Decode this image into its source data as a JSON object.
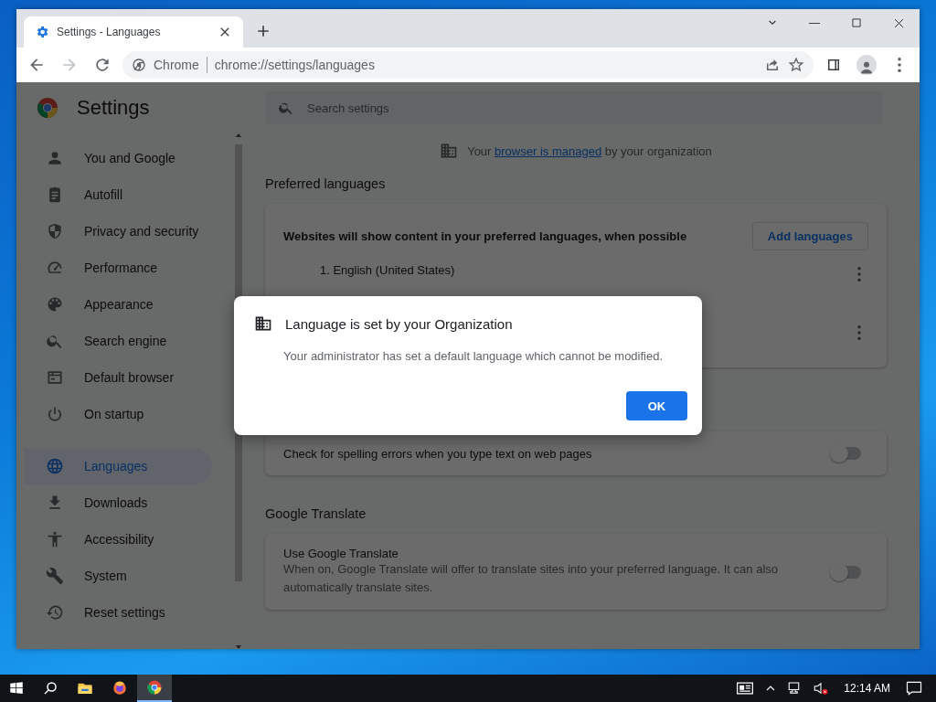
{
  "tab": {
    "title": "Settings - Languages",
    "selected": true
  },
  "omnibox": {
    "chip": "Chrome",
    "url": "chrome://settings/languages"
  },
  "settings_header": {
    "title": "Settings",
    "search_placeholder": "Search settings"
  },
  "sidebar": {
    "groups": [
      {
        "items": [
          {
            "label": "You and Google",
            "selected": false
          },
          {
            "label": "Autofill",
            "selected": false
          },
          {
            "label": "Privacy and security",
            "selected": false
          },
          {
            "label": "Performance",
            "selected": false
          },
          {
            "label": "Appearance",
            "selected": false
          },
          {
            "label": "Search engine",
            "selected": false
          },
          {
            "label": "Default browser",
            "selected": false
          },
          {
            "label": "On startup",
            "selected": false
          }
        ]
      },
      {
        "items": [
          {
            "label": "Languages",
            "selected": true
          },
          {
            "label": "Downloads",
            "selected": false
          },
          {
            "label": "Accessibility",
            "selected": false
          },
          {
            "label": "System",
            "selected": false
          },
          {
            "label": "Reset settings",
            "selected": false
          }
        ]
      }
    ]
  },
  "managed_notice": {
    "before": "Your",
    "link": "browser is managed",
    "after": "by your organization"
  },
  "preferred_languages": {
    "heading": "Preferred languages",
    "description": "Websites will show content in your preferred languages, when possible",
    "add_button": "Add languages",
    "rows": [
      {
        "kind": "language",
        "label": "1. English (United States)"
      },
      {
        "kind": "covered"
      }
    ]
  },
  "spell_check": {
    "label": "Check for spelling errors when you type text on web pages",
    "on": false
  },
  "google_translate": {
    "heading": "Google Translate",
    "title": "Use Google Translate",
    "description": "When on, Google Translate will offer to translate sites into your preferred language. It can also automatically translate sites.",
    "on": false
  },
  "dialog": {
    "title": "Language is set by your Organization",
    "message": "Your administrator has set a default language which cannot be modified.",
    "button": "OK"
  },
  "taskbar": {
    "apps": [
      {
        "kind": "explorer",
        "active": false
      },
      {
        "kind": "firefox",
        "active": false
      },
      {
        "kind": "chrome",
        "active": true
      }
    ],
    "time": "12:14 AM"
  }
}
